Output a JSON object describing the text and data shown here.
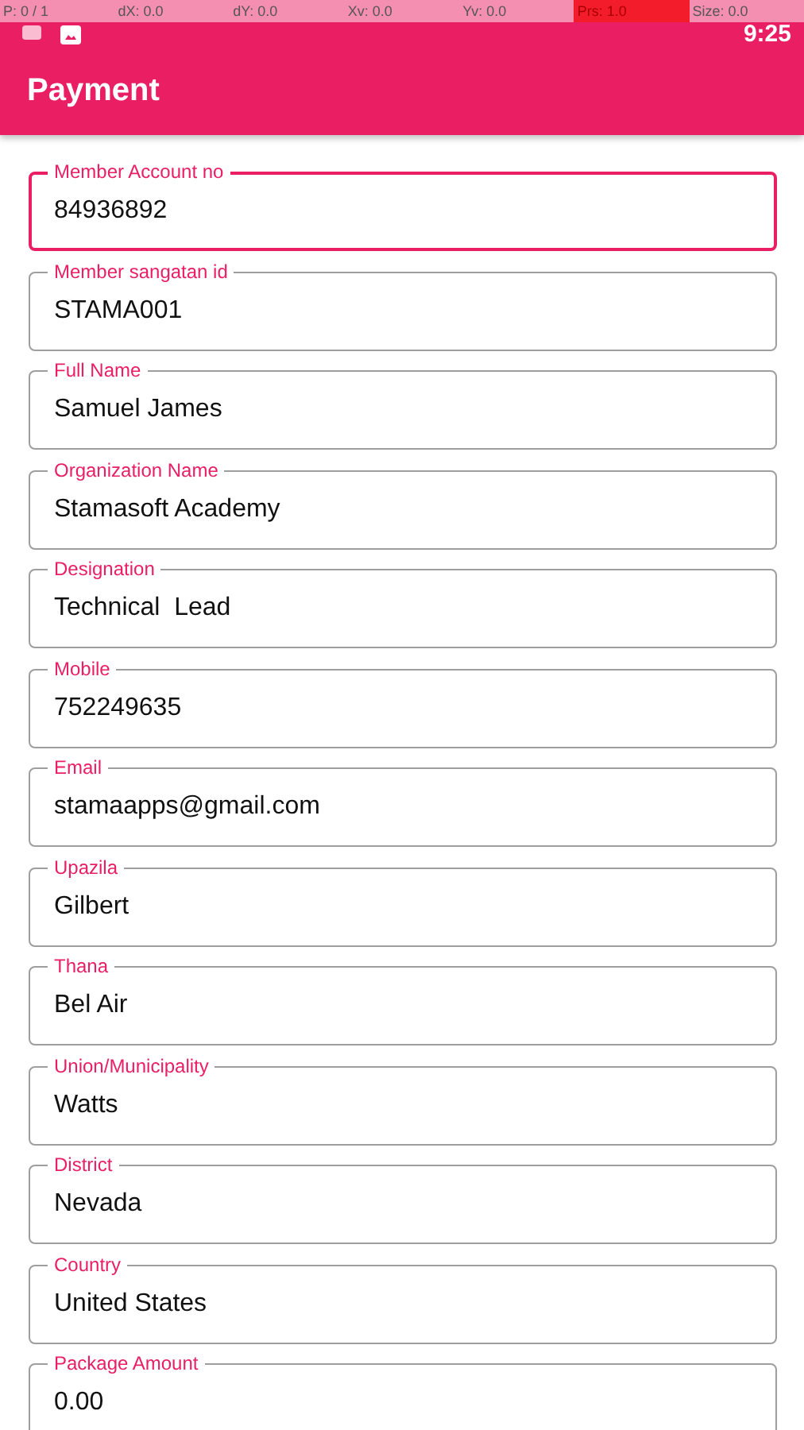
{
  "pointer_overlay": [
    {
      "text": "P: 0 / 1",
      "alert": false
    },
    {
      "text": "dX: 0.0",
      "alert": false
    },
    {
      "text": "dY: 0.0",
      "alert": false
    },
    {
      "text": "Xv: 0.0",
      "alert": false
    },
    {
      "text": "Yv: 0.0",
      "alert": false
    },
    {
      "text": "Prs: 1.0",
      "alert": true
    },
    {
      "text": "Size: 0.0",
      "alert": false
    }
  ],
  "status_bar": {
    "time": "9:25"
  },
  "app_bar": {
    "title": "Payment"
  },
  "fields": [
    {
      "label": "Member Account no",
      "value": "84936892",
      "focused": true
    },
    {
      "label": "Member sangatan id",
      "value": "STAMA001",
      "focused": false
    },
    {
      "label": "Full Name",
      "value": "Samuel James",
      "focused": false
    },
    {
      "label": "Organization Name",
      "value": "Stamasoft Academy",
      "focused": false
    },
    {
      "label": "Designation",
      "value": "Technical  Lead",
      "focused": false
    },
    {
      "label": "Mobile",
      "value": "752249635",
      "focused": false
    },
    {
      "label": "Email",
      "value": "stamaapps@gmail.com",
      "focused": false
    },
    {
      "label": "Upazila",
      "value": "Gilbert",
      "focused": false
    },
    {
      "label": "Thana",
      "value": "Bel Air",
      "focused": false
    },
    {
      "label": "Union/Municipality",
      "value": "Watts",
      "focused": false
    },
    {
      "label": "District",
      "value": "Nevada",
      "focused": false
    },
    {
      "label": "Country",
      "value": "United States",
      "focused": false
    },
    {
      "label": "Package Amount",
      "value": "0.00",
      "focused": false
    }
  ]
}
